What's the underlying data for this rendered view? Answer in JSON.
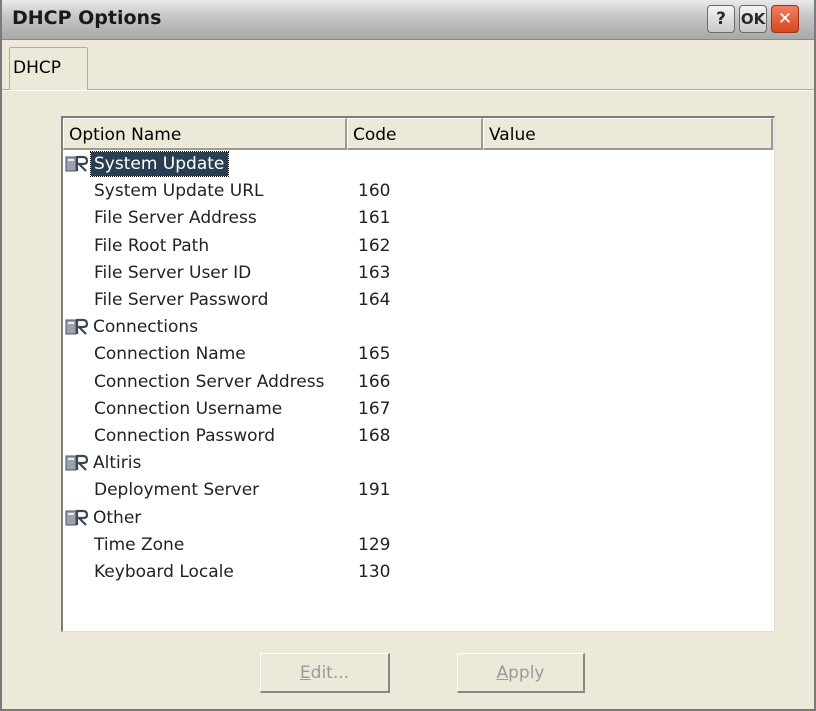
{
  "window": {
    "title": "DHCP Options",
    "help_label": "?",
    "ok_label": "OK",
    "close_label": "✕"
  },
  "tabs": [
    {
      "label": "DHCP",
      "selected": true
    }
  ],
  "list": {
    "columns": [
      "Option Name",
      "Code",
      "Value"
    ],
    "rows": [
      {
        "type": "group",
        "name": "System Update",
        "code": "",
        "value": "",
        "selected": true
      },
      {
        "type": "item",
        "name": "System Update URL",
        "code": "160",
        "value": ""
      },
      {
        "type": "item",
        "name": "File Server Address",
        "code": "161",
        "value": ""
      },
      {
        "type": "item",
        "name": "File Root Path",
        "code": "162",
        "value": ""
      },
      {
        "type": "item",
        "name": "File Server User ID",
        "code": "163",
        "value": ""
      },
      {
        "type": "item",
        "name": "File Server Password",
        "code": "164",
        "value": ""
      },
      {
        "type": "group",
        "name": "Connections",
        "code": "",
        "value": ""
      },
      {
        "type": "item",
        "name": "Connection Name",
        "code": "165",
        "value": ""
      },
      {
        "type": "item",
        "name": "Connection Server Address",
        "code": "166",
        "value": ""
      },
      {
        "type": "item",
        "name": "Connection Username",
        "code": "167",
        "value": ""
      },
      {
        "type": "item",
        "name": "Connection Password",
        "code": "168",
        "value": ""
      },
      {
        "type": "group",
        "name": "Altiris",
        "code": "",
        "value": ""
      },
      {
        "type": "item",
        "name": "Deployment Server",
        "code": "191",
        "value": ""
      },
      {
        "type": "group",
        "name": "Other",
        "code": "",
        "value": ""
      },
      {
        "type": "item",
        "name": "Time Zone",
        "code": "129",
        "value": ""
      },
      {
        "type": "item",
        "name": "Keyboard Locale",
        "code": "130",
        "value": ""
      }
    ]
  },
  "buttons": {
    "edit": {
      "mnemonic": "E",
      "rest": "dit...",
      "enabled": false
    },
    "apply": {
      "mnemonic": "A",
      "rest": "pply",
      "enabled": false
    }
  },
  "icons": {
    "group": "folder-key-icon"
  },
  "colors": {
    "selection": "#2a3e52",
    "close": "#d9461e",
    "disabled_text": "#9a9a9a"
  }
}
